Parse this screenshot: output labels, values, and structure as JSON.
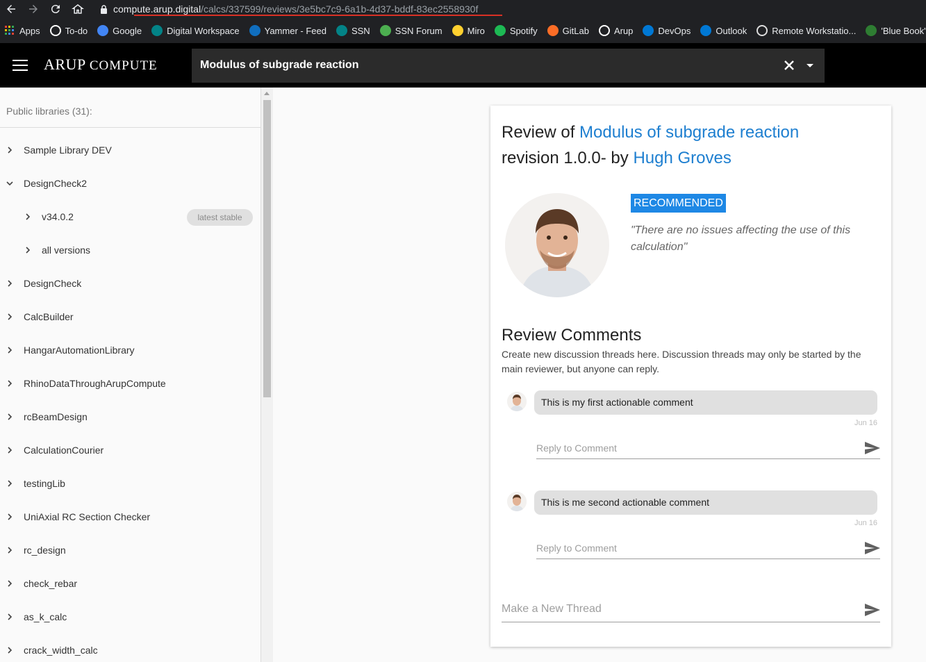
{
  "browser": {
    "url_host": "compute.arup.digital",
    "url_path": "/calcs/337599/reviews/3e5bc7c9-6a1b-4d37-bddf-83ec2558930f"
  },
  "bookmarks": [
    {
      "label": "Apps",
      "icon": "apps-grid-icon",
      "color": "#ea4335"
    },
    {
      "label": "To-do",
      "icon": "github-icon",
      "color": "#ffffff"
    },
    {
      "label": "Google",
      "icon": "google-icon",
      "color": "#4285f4"
    },
    {
      "label": "Digital Workspace",
      "icon": "sharepoint-icon",
      "color": "#038387"
    },
    {
      "label": "Yammer - Feed",
      "icon": "yammer-icon",
      "color": "#106ebe"
    },
    {
      "label": "SSN",
      "icon": "sharepoint-icon",
      "color": "#038387"
    },
    {
      "label": "SSN Forum",
      "icon": "forum-icon",
      "color": "#4caf50"
    },
    {
      "label": "Miro",
      "icon": "miro-icon",
      "color": "#ffd02f"
    },
    {
      "label": "Spotify",
      "icon": "spotify-icon",
      "color": "#1db954"
    },
    {
      "label": "GitLab",
      "icon": "gitlab-icon",
      "color": "#fc6d26"
    },
    {
      "label": "Arup",
      "icon": "github-icon",
      "color": "#ffffff"
    },
    {
      "label": "DevOps",
      "icon": "devops-icon",
      "color": "#0078d4"
    },
    {
      "label": "Outlook",
      "icon": "outlook-icon",
      "color": "#0078d4"
    },
    {
      "label": "Remote Workstatio...",
      "icon": "globe-icon",
      "color": "#dddddd"
    },
    {
      "label": "'Blue Book' h",
      "icon": "bluebook-icon",
      "color": "#2e7d32"
    }
  ],
  "header": {
    "brand_main": "ARUP",
    "brand_sub": "COMPUTE",
    "search_value": "Modulus of subgrade reaction"
  },
  "sidebar": {
    "header": "Public libraries (31):",
    "stable_badge": "latest stable",
    "items": [
      {
        "label": "Sample Library DEV",
        "expanded": false,
        "level": 0
      },
      {
        "label": "DesignCheck2",
        "expanded": true,
        "level": 0
      },
      {
        "label": "v34.0.2",
        "expanded": false,
        "level": 1
      },
      {
        "label": "all versions",
        "expanded": false,
        "level": 1
      },
      {
        "label": "DesignCheck",
        "expanded": false,
        "level": 0
      },
      {
        "label": "CalcBuilder",
        "expanded": false,
        "level": 0
      },
      {
        "label": "HangarAutomationLibrary",
        "expanded": false,
        "level": 0
      },
      {
        "label": "RhinoDataThroughArupCompute",
        "expanded": false,
        "level": 0
      },
      {
        "label": "rcBeamDesign",
        "expanded": false,
        "level": 0
      },
      {
        "label": "CalculationCourier",
        "expanded": false,
        "level": 0
      },
      {
        "label": "testingLib",
        "expanded": false,
        "level": 0
      },
      {
        "label": "UniAxial RC Section Checker",
        "expanded": false,
        "level": 0
      },
      {
        "label": "rc_design",
        "expanded": false,
        "level": 0
      },
      {
        "label": "check_rebar",
        "expanded": false,
        "level": 0
      },
      {
        "label": "as_k_calc",
        "expanded": false,
        "level": 0
      },
      {
        "label": "crack_width_calc",
        "expanded": false,
        "level": 0
      }
    ]
  },
  "review": {
    "title_prefix": "Review of",
    "calc_name": "Modulus of subgrade reaction",
    "revision_text": "revision 1.0.0- by",
    "reviewer": "Hugh Groves",
    "status": "RECOMMENDED",
    "status_color": "#1e88e5",
    "quote": "\"There are no issues affecting the use of this calculation\""
  },
  "comments": {
    "title": "Review Comments",
    "description": "Create new discussion threads here. Discussion threads may only be started by the main reviewer, but anyone can reply.",
    "reply_placeholder": "Reply to Comment",
    "new_thread_placeholder": "Make a New Thread",
    "threads": [
      {
        "text": "This is my first actionable comment",
        "date": "Jun 16"
      },
      {
        "text": "This is me second actionable comment",
        "date": "Jun 16"
      }
    ]
  },
  "colors": {
    "link": "#1e7fd0",
    "appbar": "#000000"
  }
}
